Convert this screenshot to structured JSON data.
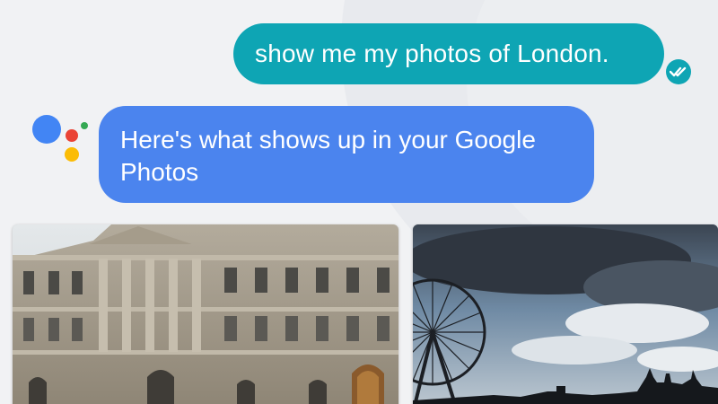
{
  "conversation": {
    "user_message": "show me my photos of London.",
    "assistant_message": "Here's what shows up in your Google Photos"
  },
  "photos": [
    {
      "name": "buckingham-palace-photo"
    },
    {
      "name": "london-eye-photo"
    }
  ],
  "colors": {
    "user_bubble": "#0ea5b4",
    "assistant_bubble": "#4b84ee",
    "background": "#f1f2f4",
    "logo_blue": "#4285f4",
    "logo_red": "#ea4335",
    "logo_yellow": "#fbbc05",
    "logo_green": "#34a853"
  },
  "icons": {
    "read_receipt": "double-check-icon",
    "assistant": "google-assistant-logo"
  }
}
